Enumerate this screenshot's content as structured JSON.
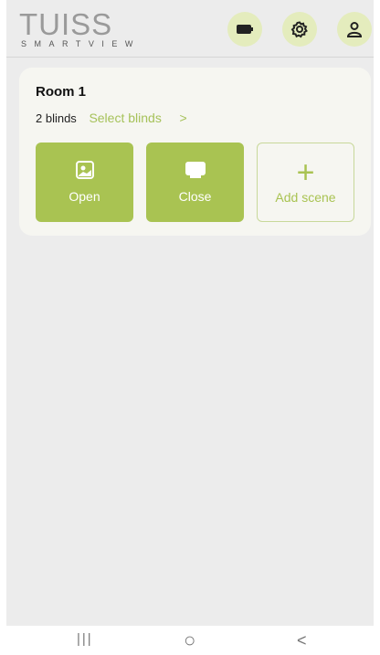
{
  "header": {
    "logo_main": "TUISS",
    "logo_sub": "SMARTVIEW",
    "icons": [
      "battery-icon",
      "gear-icon",
      "user-icon"
    ],
    "accent_bg": "#e4ecbd"
  },
  "room": {
    "title": "Room 1",
    "blinds_count": "2 blinds",
    "select_label": "Select blinds",
    "chevron": ">"
  },
  "scenes": [
    {
      "label": "Open",
      "icon": "sun-window-icon"
    },
    {
      "label": "Close",
      "icon": "closed-blind-icon"
    },
    {
      "label": "Add scene",
      "icon": "plus-icon",
      "symbol": "+"
    }
  ],
  "colors": {
    "brand_green": "#a9c352",
    "link_green": "#a6c25a",
    "background": "#ececec"
  },
  "system_nav": {
    "recents": "|||",
    "home": "○",
    "back": "<"
  }
}
